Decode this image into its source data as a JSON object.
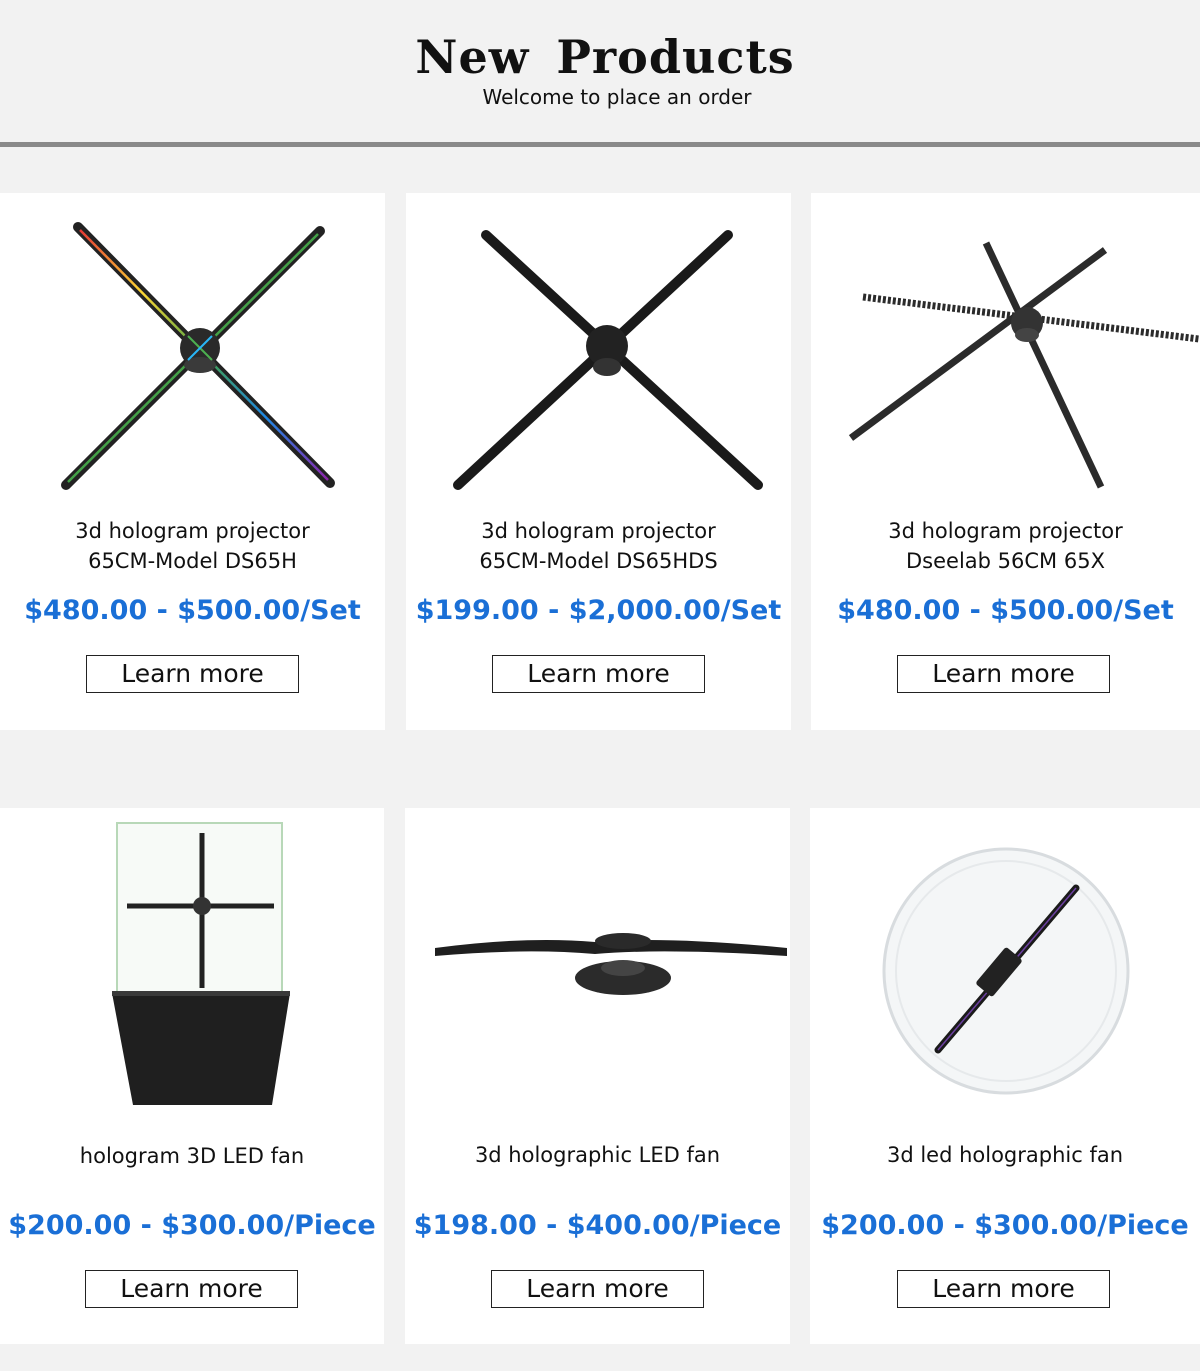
{
  "header": {
    "title": "New  Products",
    "subtitle": "Welcome to place an order"
  },
  "products": [
    {
      "name_line1": "3d hologram projector",
      "name_line2": "65CM-Model DS65H",
      "price": "$480.00 - $500.00/Set",
      "button": "Learn more",
      "image_icon": "hologram-fan-4-blade-rgb-icon"
    },
    {
      "name_line1": "3d hologram projector",
      "name_line2": "65CM-Model DS65HDS",
      "price": "$199.00 - $2,000.00/Set",
      "button": "Learn more",
      "image_icon": "hologram-fan-4-blade-icon"
    },
    {
      "name_line1": "3d hologram projector",
      "name_line2": "Dseelab 56CM 65X",
      "price": "$480.00 - $500.00/Set",
      "button": "Learn more",
      "image_icon": "hologram-fan-6-blade-icon"
    },
    {
      "name_line1": "hologram 3D LED fan",
      "name_line2": "",
      "price": "$200.00 - $300.00/Piece",
      "button": "Learn more",
      "image_icon": "hologram-display-cabinet-icon"
    },
    {
      "name_line1": "3d holographic LED fan",
      "name_line2": "",
      "price": "$198.00 - $400.00/Piece",
      "button": "Learn more",
      "image_icon": "hologram-fan-side-view-icon"
    },
    {
      "name_line1": "3d led holographic fan",
      "name_line2": "",
      "price": "$200.00 - $300.00/Piece",
      "button": "Learn more",
      "image_icon": "hologram-fan-with-dome-icon"
    }
  ],
  "colors": {
    "price": "#1a6fd6",
    "background": "#f2f2f2",
    "card": "#ffffff",
    "rule": "#8a8a8a"
  }
}
